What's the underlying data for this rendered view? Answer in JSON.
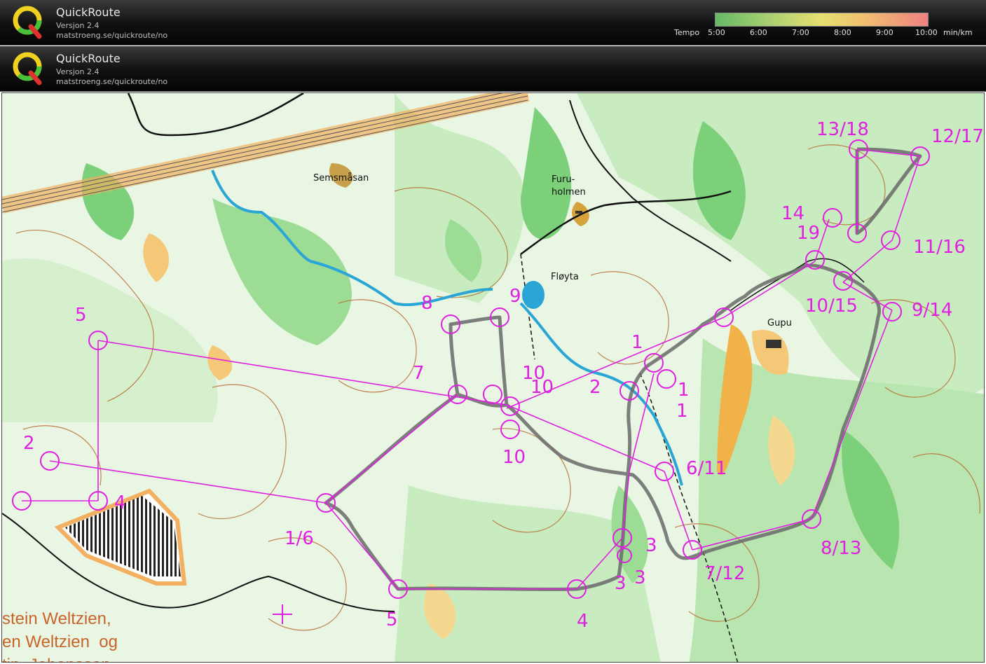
{
  "headers": [
    {
      "app_name": "QuickRoute",
      "version": "Versjon 2.4",
      "url": "matstroeng.se/quickroute/no",
      "tempo": {
        "label": "Tempo",
        "ticks": [
          "5:00",
          "6:00",
          "7:00",
          "8:00",
          "9:00",
          "10:00"
        ],
        "unit": "min/km"
      }
    },
    {
      "app_name": "QuickRoute",
      "version": "Versjon 2.4",
      "url": "matstroeng.se/quickroute/no"
    }
  ],
  "map": {
    "place_names": [
      "Semsmåsan",
      "Furu-",
      "holmen",
      "Fløyta",
      "Gupu"
    ],
    "control_labels": [
      "5",
      "2",
      "4",
      "1/6",
      "5",
      "4",
      "3",
      "3",
      "3",
      "8",
      "9",
      "7",
      "10",
      "10",
      "10",
      "2",
      "1",
      "1",
      "1",
      "6/11",
      "7/12",
      "8/13",
      "9/14",
      "10/15",
      "11/16",
      "12/17",
      "13/18",
      "14",
      "19"
    ],
    "credit_lines": [
      "stein Weltzien,",
      "en Weltzien  og",
      "tin  Johansson"
    ],
    "colors": {
      "course": "#e020e0",
      "route": "#6a6a6a",
      "forest_light": "#c8ecc0",
      "forest_green": "#7cd07a",
      "open": "#f2b24a",
      "water": "#2aa6d6",
      "contour": "#b5652a"
    }
  }
}
